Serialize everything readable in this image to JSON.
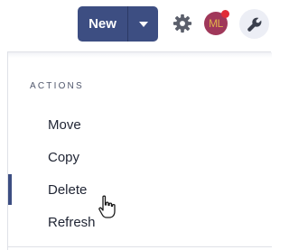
{
  "toolbar": {
    "new_label": "New",
    "dropdown_icon": "caret-down-icon",
    "settings_icon": "gear-icon",
    "tools_icon": "wrench-icon",
    "accent_color": "#3d4e82"
  },
  "user": {
    "initials": "ML",
    "has_notification": true
  },
  "actions_menu": {
    "heading": "ACTIONS",
    "items": [
      {
        "label": "Move",
        "active": false
      },
      {
        "label": "Copy",
        "active": false
      },
      {
        "label": "Delete",
        "active": true
      },
      {
        "label": "Refresh",
        "active": false
      }
    ]
  },
  "pointer": {
    "icon": "hand-pointer-icon",
    "hovering": "Delete"
  }
}
